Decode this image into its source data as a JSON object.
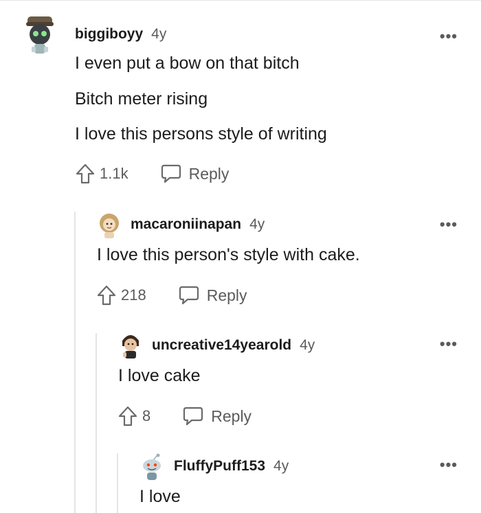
{
  "comments": [
    {
      "username": "biggiboyy",
      "age": "4y",
      "lines": [
        "I even put a bow on that bitch",
        "Bitch meter rising",
        "I love this persons style of writing"
      ],
      "upvotes": "1.1k",
      "reply_label": "Reply",
      "avatar_icon": "robot-avatar-icon"
    },
    {
      "username": "macaroniinapan",
      "age": "4y",
      "lines": [
        "I love this person's style with cake."
      ],
      "upvotes": "218",
      "reply_label": "Reply",
      "avatar_icon": "curly-hair-avatar-icon"
    },
    {
      "username": "uncreative14yearold",
      "age": "4y",
      "lines": [
        "I love cake"
      ],
      "upvotes": "8",
      "reply_label": "Reply",
      "avatar_icon": "character-avatar-icon"
    },
    {
      "username": "FluffyPuff153",
      "age": "4y",
      "lines": [
        "I love"
      ],
      "avatar_icon": "snoo-avatar-icon"
    }
  ],
  "more_label": "•••",
  "colors": {
    "text": "#1c1c1c",
    "meta": "#5b5b5b",
    "thread_line": "#e5e5e5"
  }
}
